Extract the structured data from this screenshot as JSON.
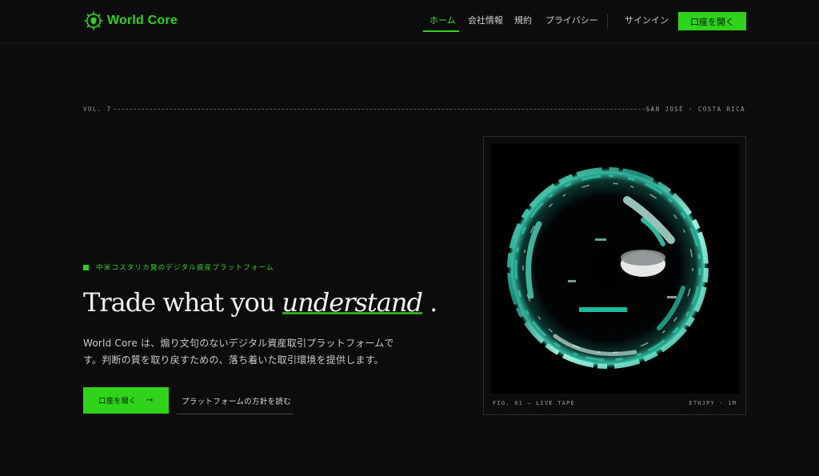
{
  "brand": {
    "name": "World Core",
    "logo_icon": "gear-shield-icon",
    "accent": "#2fd41a"
  },
  "nav": {
    "items": [
      {
        "label": "ホーム",
        "active": true
      },
      {
        "label": "会社情報",
        "active": false
      },
      {
        "label": "規約",
        "active": false
      },
      {
        "label": "プライバシー",
        "active": false
      }
    ],
    "signin": "サインイン",
    "open_account": "口座を開く"
  },
  "meta": {
    "volume": "VOL. 7",
    "location": "SAN JOSÉ · COSTA RICA"
  },
  "hero": {
    "eyebrow": "中米コスタリカ発のデジタル資産プラットフォーム",
    "headline_pre": "Trade what you",
    "headline_em": "understand",
    "headline_post": ".",
    "body": "World Core は、煽り文句のないデジタル資産取引プラットフォームです。判断の質を取り戻すための、落ち着いた取引環境を提供します。",
    "cta_primary": "口座を開く",
    "cta_primary_icon": "arrow-right-icon",
    "cta_secondary": "プラットフォームの方針を読む"
  },
  "figure": {
    "caption": "FIG. 01 — LIVE TAPE",
    "pair": "ETHJPY · 1M",
    "image_icon": "iridescent-bubble-image"
  }
}
